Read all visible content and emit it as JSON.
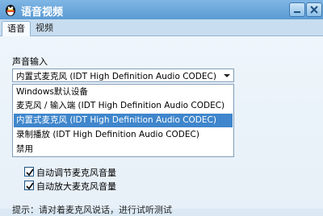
{
  "window": {
    "title": "语音视频"
  },
  "tabs": [
    {
      "label": "语音",
      "active": true
    },
    {
      "label": "视频",
      "active": false
    }
  ],
  "audio_input": {
    "label": "声音输入",
    "selected_value": "内置式麦克风 (IDT High Definition Audio CODEC)",
    "options": [
      "Windows默认设备",
      "麦克风 / 输入端 (IDT High Definition Audio CODEC)",
      "内置式麦克风 (IDT High Definition Audio CODEC)",
      "录制播放 (IDT High Definition Audio CODEC)",
      "禁用"
    ],
    "highlighted_index": 2
  },
  "checkboxes": [
    {
      "label": "自动调节麦克风音量",
      "checked": true
    },
    {
      "label": "自动放大麦克风音量",
      "checked": true
    }
  ],
  "footer_hint": "提示：请对着麦克风说话，进行试听测试",
  "colors": {
    "titlebar": "#5b9bd3",
    "highlight": "#3f86cc"
  }
}
